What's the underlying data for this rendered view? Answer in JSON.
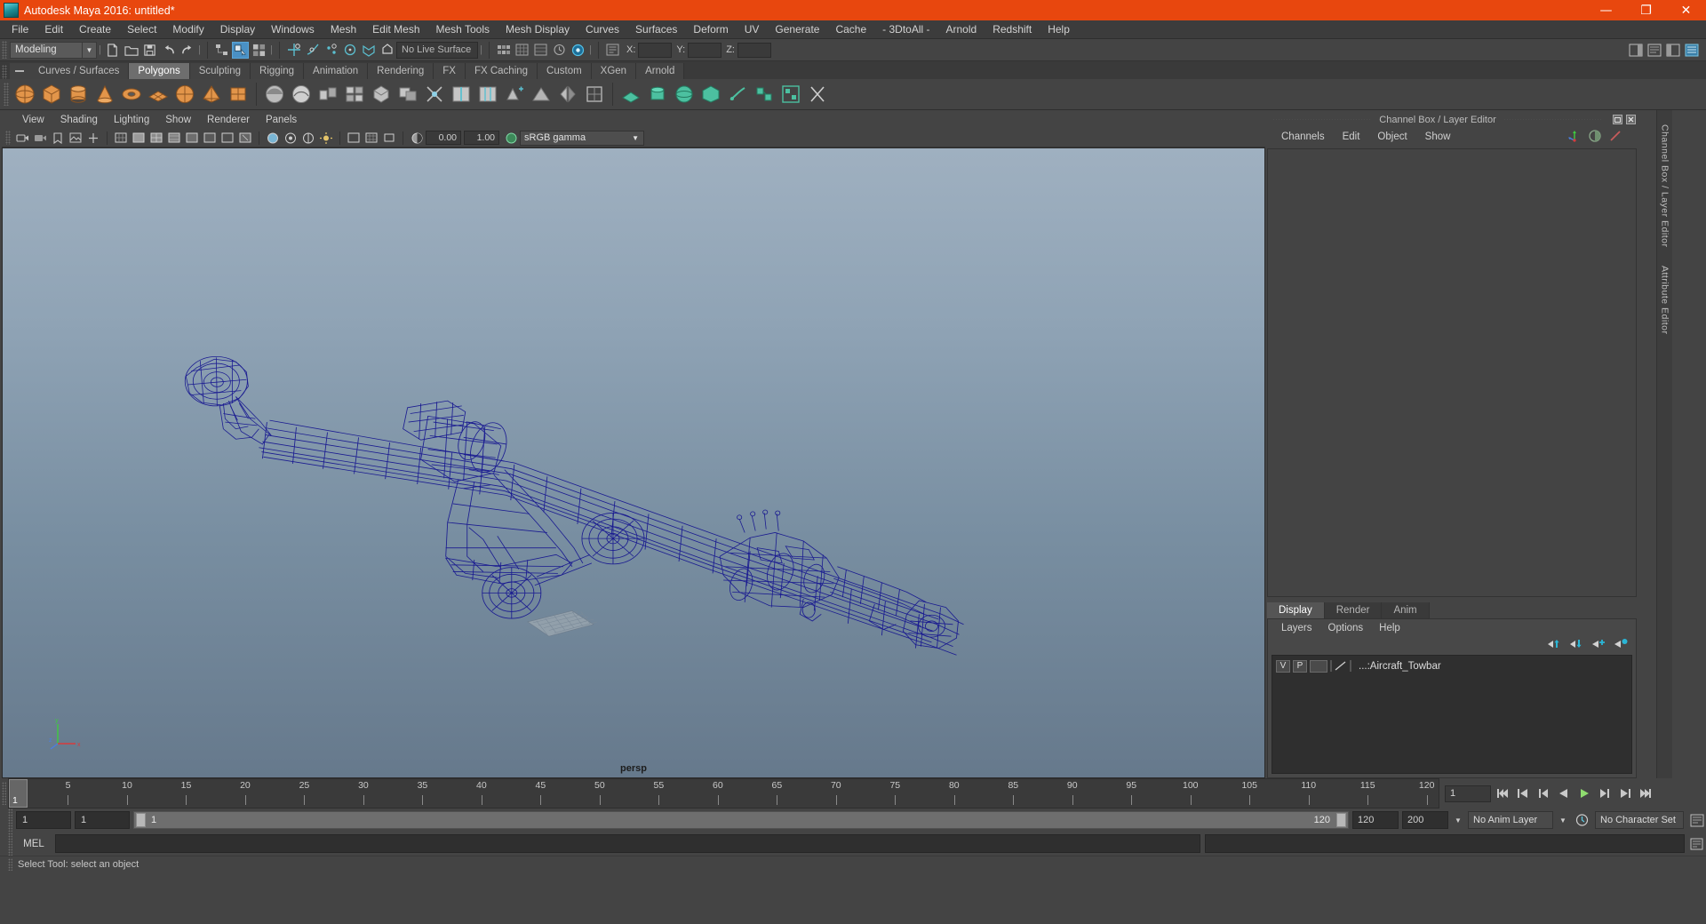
{
  "window": {
    "title": "Autodesk Maya 2016: untitled*",
    "logo_icon": "maya-logo-icon",
    "controls": [
      {
        "name": "minimize",
        "glyph": "—"
      },
      {
        "name": "maximize",
        "glyph": "❐"
      },
      {
        "name": "close",
        "glyph": "✕"
      }
    ]
  },
  "menubar": {
    "items": [
      "File",
      "Edit",
      "Create",
      "Select",
      "Modify",
      "Display",
      "Windows",
      "Mesh",
      "Edit Mesh",
      "Mesh Tools",
      "Mesh Display",
      "Curves",
      "Surfaces",
      "Deform",
      "UV",
      "Generate",
      "Cache",
      "- 3DtoAll -",
      "Arnold",
      "Redshift",
      "Help"
    ]
  },
  "status_row": {
    "mode_menu": "Modeling",
    "live_surface": "No Live Surface",
    "axis_labels": [
      "X:",
      "Y:",
      "Z:"
    ],
    "axis_values": [
      "",
      "",
      ""
    ]
  },
  "shelf_tabs": {
    "items": [
      "Curves / Surfaces",
      "Polygons",
      "Sculpting",
      "Rigging",
      "Animation",
      "Rendering",
      "FX",
      "FX Caching",
      "Custom",
      "XGen",
      "Arnold"
    ],
    "active": "Polygons"
  },
  "viewport_menu": {
    "items": [
      "View",
      "Shading",
      "Lighting",
      "Show",
      "Renderer",
      "Panels"
    ]
  },
  "viewport_toolbar": {
    "exposure_value": "0.00",
    "gamma_value": "1.00",
    "color_space": "sRGB gamma"
  },
  "viewport": {
    "camera_label": "persp",
    "axis_labels": {
      "x": "x",
      "y": "y",
      "z": "z"
    },
    "wireframe_color": "#1b1b96",
    "background_top": "#9fb0c0",
    "background_bottom": "#66798c",
    "model_name": "Aircraft_Towbar"
  },
  "channel_box": {
    "panel_title": "Channel Box / Layer Editor",
    "menus": [
      "Channels",
      "Edit",
      "Object",
      "Show"
    ],
    "quick_icons": [
      "move-axis-icon",
      "half-circle-icon",
      "slash-icon"
    ],
    "titlebar_buttons": [
      "undock-icon",
      "close-icon"
    ]
  },
  "layer_editor": {
    "tabs": [
      "Display",
      "Render",
      "Anim"
    ],
    "active_tab": "Display",
    "menus": [
      "Layers",
      "Options",
      "Help"
    ],
    "buttons": [
      "move-layer-up-icon",
      "move-layer-down-icon",
      "new-layer-icon",
      "new-layer-from-selected-icon"
    ],
    "layers": [
      {
        "visibility": "V",
        "playback": "P",
        "type": "",
        "name": "...:Aircraft_Towbar"
      }
    ]
  },
  "dock_tabs": {
    "items": [
      "Channel Box / Layer Editor",
      "Attribute Editor"
    ]
  },
  "time_slider": {
    "current_frame": "1",
    "tick_labels": [
      "5",
      "10",
      "15",
      "20",
      "25",
      "30",
      "35",
      "40",
      "45",
      "50",
      "55",
      "60",
      "65",
      "70",
      "75",
      "80",
      "85",
      "90",
      "95",
      "100",
      "105",
      "110",
      "115",
      "120"
    ],
    "frame_field": "1",
    "playback_buttons": [
      "go-to-start-icon",
      "step-back-key-icon",
      "step-back-frame-icon",
      "play-backwards-icon",
      "play-forwards-icon",
      "step-forward-frame-icon",
      "step-forward-key-icon",
      "go-to-end-icon"
    ]
  },
  "range_slider": {
    "anim_start": "1",
    "range_start": "1",
    "bar_start_label": "1",
    "bar_end_label": "120",
    "range_end": "120",
    "anim_end": "200",
    "anim_layer": "No Anim Layer",
    "character_set": "No Character Set",
    "icons": [
      "auto-key-icon",
      "animation-preferences-icon"
    ]
  },
  "command_line": {
    "language_label": "MEL",
    "input_value": "",
    "output_value": "",
    "script_editor_icon": "script-editor-icon"
  },
  "help_line": {
    "text": "Select Tool: select an object"
  }
}
